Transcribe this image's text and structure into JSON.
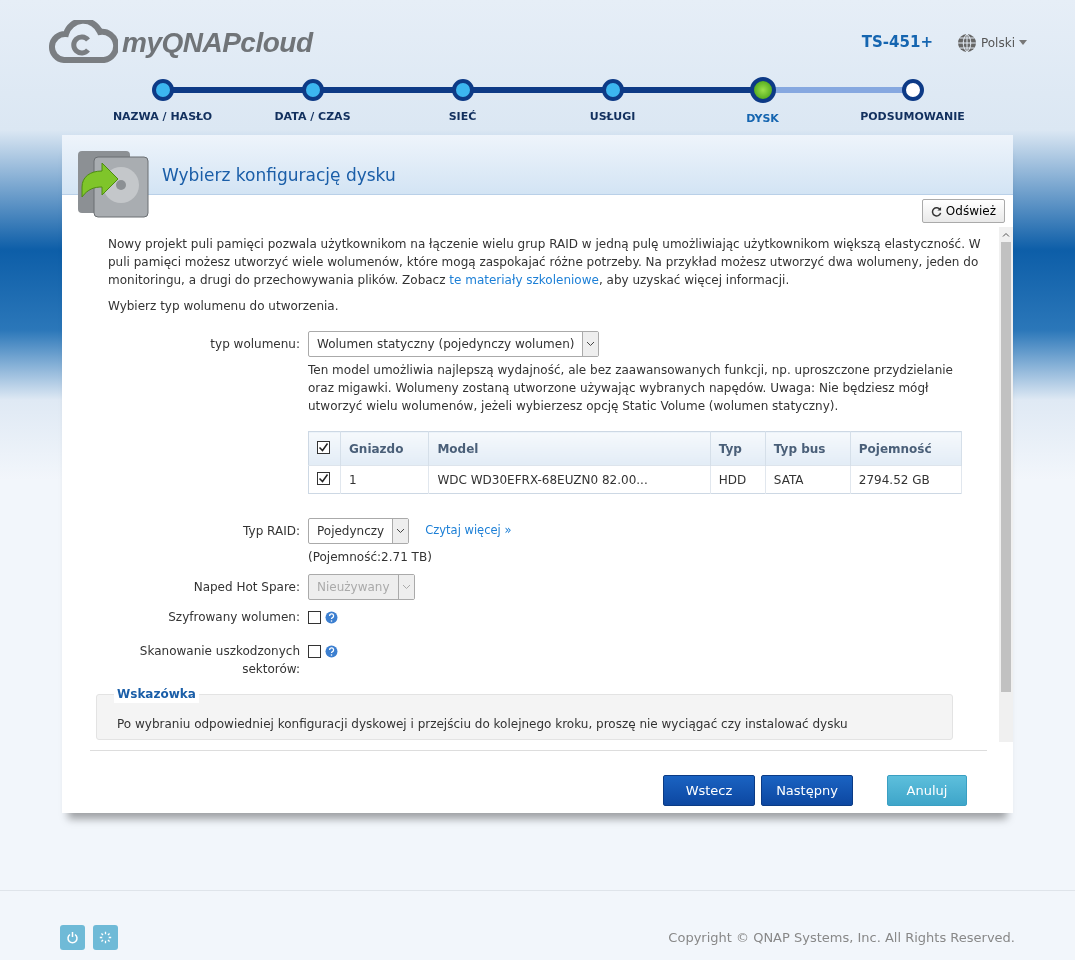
{
  "brand": {
    "name": "myQNAPcloud"
  },
  "device": "TS-451+",
  "language": "Polski",
  "steps": [
    {
      "label": "NAZWA / HASŁO",
      "completed": true,
      "selected": false
    },
    {
      "label": "DATA / CZAS",
      "completed": true,
      "selected": false
    },
    {
      "label": "SIEĆ",
      "completed": true,
      "selected": false
    },
    {
      "label": "USŁUGI",
      "completed": true,
      "selected": false
    },
    {
      "label": "DYSK",
      "completed": false,
      "selected": true
    },
    {
      "label": "PODSUMOWANIE",
      "completed": false,
      "selected": false
    }
  ],
  "panel": {
    "title": "Wybierz konfigurację dysku",
    "refresh_button": "Odśwież",
    "intro_before": "Nowy projekt puli pamięci pozwala użytkownikom na łączenie wielu grup RAID w jedną pulę umożliwiając użytkownikom większą elastyczność. W puli pamięci możesz utworzyć wiele wolumenów, które mogą zaspokajać różne potrzeby. Na przykład możesz utworzyć dwa wolumeny, jeden do monitoringu, a drugi do przechowywania plików. Zobacz ",
    "intro_link": "te materiały szkoleniowe",
    "intro_after": ", aby uzyskać więcej informacji.",
    "prompt": "Wybierz typ wolumenu do utworzenia.",
    "volume_type": {
      "label": "typ wolumenu:",
      "value": "Wolumen statyczny (pojedynczy wolumen)",
      "description": "Ten model umożliwia najlepszą wydajność, ale bez zaawansowanych funkcji, np. uproszczone przydzielanie oraz migawki. Wolumeny zostaną utworzone używając wybranych napędów. Uwaga: Nie będziesz mógł utworzyć wielu wolumenów, jeżeli wybierzesz opcję Static Volume (wolumen statyczny)."
    },
    "disk_table": {
      "all_checked": true,
      "columns": [
        "Gniazdo",
        "Model",
        "Typ",
        "Typ bus",
        "Pojemność"
      ],
      "rows": [
        {
          "checked": true,
          "cells": [
            "1",
            "WDC WD30EFRX-68EUZN0 82.00...",
            "HDD",
            "SATA",
            "2794.52 GB"
          ]
        }
      ]
    },
    "raid": {
      "label": "Typ RAID:",
      "value": "Pojedynczy",
      "link": "Czytaj więcej »",
      "capacity": "(Pojemność:2.71 TB)"
    },
    "hot_spare": {
      "label": "Naped Hot Spare:",
      "value": "Nieużywany",
      "disabled": true
    },
    "options": [
      {
        "label": "Szyfrowany wolumen:",
        "checked": false
      },
      {
        "label": "Skanowanie uszkodzonych sektorów:",
        "checked": false
      }
    ],
    "tip": {
      "title": "Wskazówka",
      "text": "Po wybraniu odpowiedniej konfiguracji dyskowej i przejściu do kolejnego kroku, proszę nie wyciągać czy instalować dysku"
    },
    "buttons": [
      {
        "label": "Wstecz",
        "kind": "primary"
      },
      {
        "label": "Następny",
        "kind": "primary"
      },
      {
        "label": "Anuluj",
        "kind": "secondary"
      }
    ]
  },
  "copyright": "Copyright © QNAP Systems, Inc. All Rights Reserved."
}
